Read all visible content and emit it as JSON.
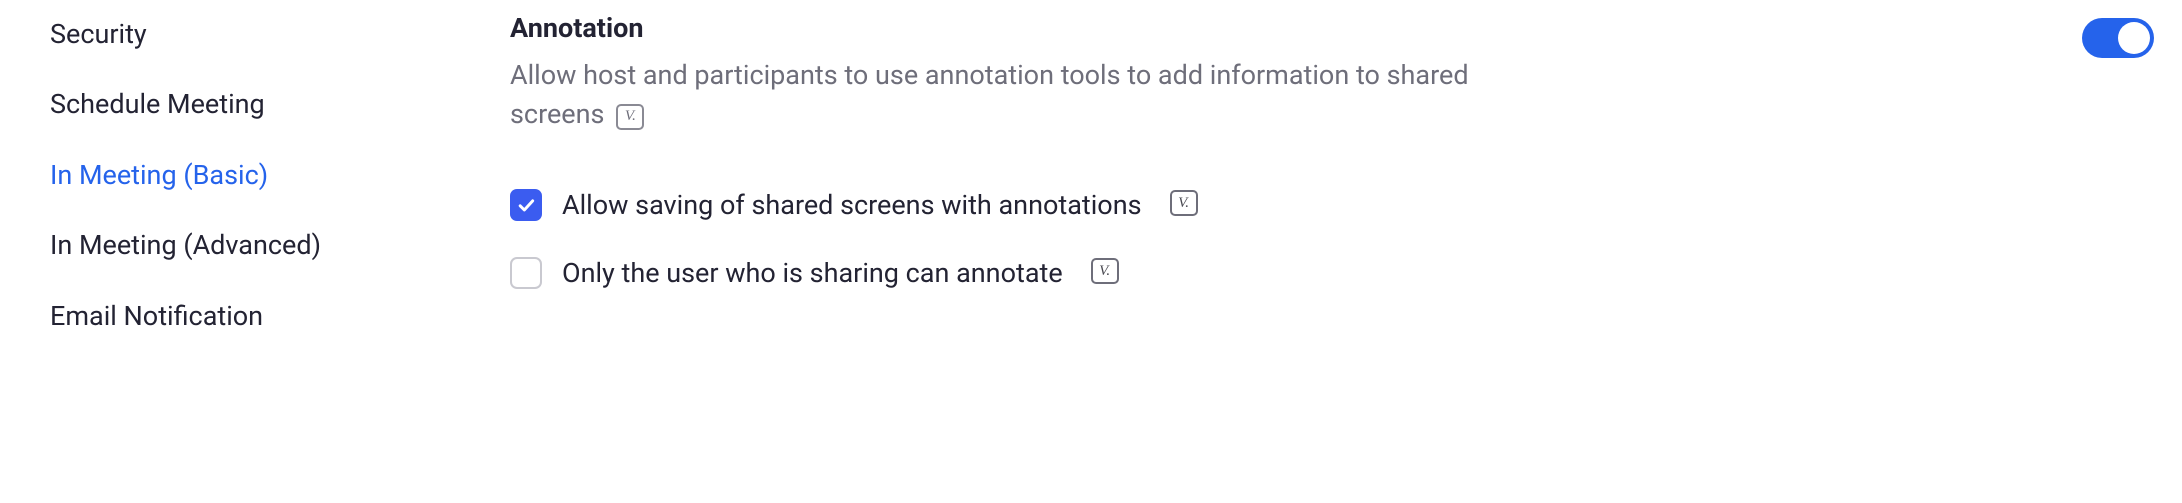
{
  "sidebar": {
    "items": [
      {
        "label": "Security",
        "active": false
      },
      {
        "label": "Schedule Meeting",
        "active": false
      },
      {
        "label": "In Meeting (Basic)",
        "active": true
      },
      {
        "label": "In Meeting (Advanced)",
        "active": false
      },
      {
        "label": "Email Notification",
        "active": false
      }
    ]
  },
  "setting": {
    "title": "Annotation",
    "description": "Allow host and participants to use annotation tools to add information to shared screens",
    "toggle_on": true,
    "info_badge": "V.",
    "options": [
      {
        "label": "Allow saving of shared screens with annotations",
        "checked": true
      },
      {
        "label": "Only the user who is sharing can annotate",
        "checked": false
      }
    ]
  }
}
